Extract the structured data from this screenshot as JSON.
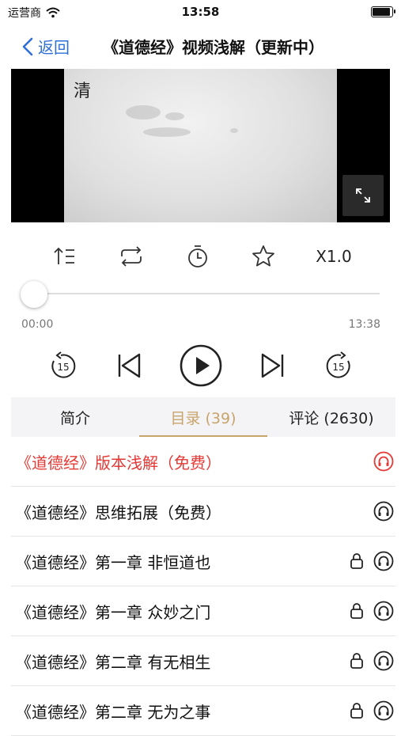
{
  "status_bar": {
    "carrier": "运营商",
    "time": "13:58"
  },
  "nav": {
    "back_label": "返回",
    "title": "《道德经》视频浅解（更新中）"
  },
  "video": {
    "seal_text": "清"
  },
  "controls": {
    "speed_label": "X1.0"
  },
  "progress": {
    "current": "00:00",
    "duration": "13:38",
    "fraction": 0
  },
  "playback": {
    "skip_back_label": "15",
    "skip_forward_label": "15"
  },
  "tabs": [
    {
      "label": "简介"
    },
    {
      "label": "目录 (39)"
    },
    {
      "label": "评论 (2630)"
    }
  ],
  "active_tab": 1,
  "episodes": [
    {
      "title": "《道德经》版本浅解（免费）",
      "locked": false,
      "highlight": true
    },
    {
      "title": "《道德经》思维拓展（免费）",
      "locked": false,
      "highlight": false
    },
    {
      "title": "《道德经》第一章 非恒道也",
      "locked": true,
      "highlight": false
    },
    {
      "title": "《道德经》第一章 众妙之门",
      "locked": true,
      "highlight": false
    },
    {
      "title": "《道德经》第二章 有无相生",
      "locked": true,
      "highlight": false
    },
    {
      "title": "《道德经》第二章 无为之事",
      "locked": true,
      "highlight": false
    }
  ],
  "colors": {
    "accent_blue": "#2f6fd8",
    "gold": "#c9a46a",
    "free_red": "#e53935"
  }
}
